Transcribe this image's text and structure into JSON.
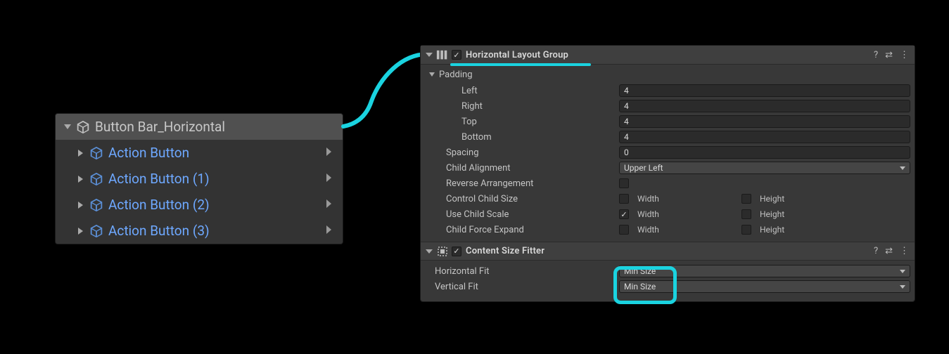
{
  "hierarchy": {
    "parent_label": "Button Bar_Horizontal",
    "children": [
      {
        "label": "Action Button"
      },
      {
        "label": "Action Button (1)"
      },
      {
        "label": "Action Button (2)"
      },
      {
        "label": "Action Button (3)"
      }
    ]
  },
  "inspector": {
    "hlg": {
      "title": "Horizontal Layout Group",
      "padding_label": "Padding",
      "left_label": "Left",
      "left_value": "4",
      "right_label": "Right",
      "right_value": "4",
      "top_label": "Top",
      "top_value": "4",
      "bottom_label": "Bottom",
      "bottom_value": "4",
      "spacing_label": "Spacing",
      "spacing_value": "0",
      "child_align_label": "Child Alignment",
      "child_align_value": "Upper Left",
      "reverse_label": "Reverse Arrangement",
      "control_label": "Control Child Size",
      "use_scale_label": "Use Child Scale",
      "force_expand_label": "Child Force Expand",
      "width_label": "Width",
      "height_label": "Height"
    },
    "csf": {
      "title": "Content Size Fitter",
      "hfit_label": "Horizontal Fit",
      "hfit_value": "Min Size",
      "vfit_label": "Vertical Fit",
      "vfit_value": "Min Size"
    },
    "help_icon": "?",
    "preset_icon": "⇄",
    "menu_icon": "⋮"
  }
}
